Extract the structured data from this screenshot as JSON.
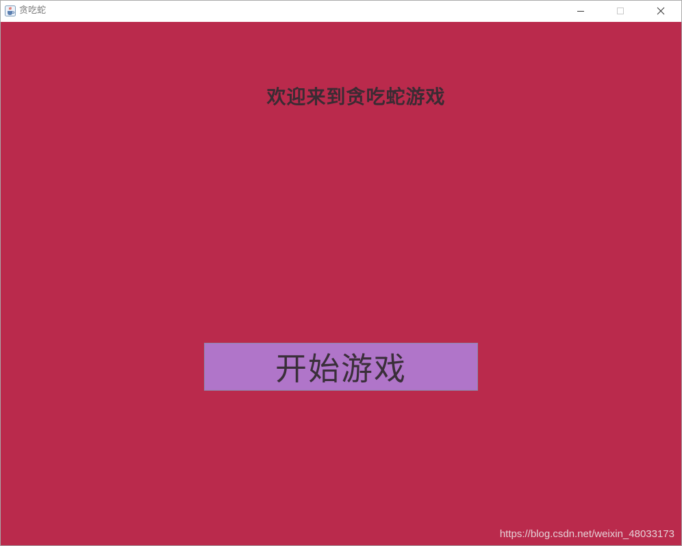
{
  "window": {
    "title": "贪吃蛇",
    "app_icon": "java-cup-icon",
    "controls": {
      "minimize": "minimize-icon",
      "maximize": "maximize-icon",
      "close": "close-icon"
    }
  },
  "game": {
    "welcome_text": "欢迎来到贪吃蛇游戏",
    "start_button_label": "开始游戏"
  },
  "watermark": "https://blog.csdn.net/weixin_48033173",
  "colors": {
    "background": "#ba2a4c",
    "button": "#b075c9",
    "text": "#3a2b33"
  }
}
